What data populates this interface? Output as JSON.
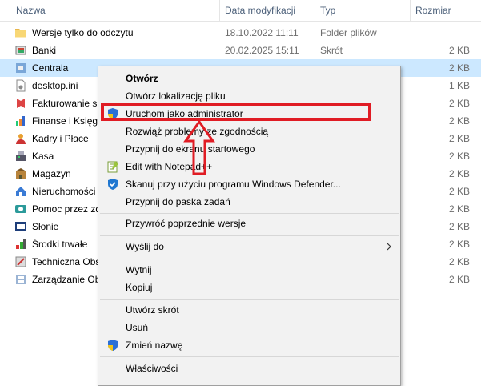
{
  "columns": {
    "name": "Nazwa",
    "date": "Data modyfikacji",
    "type": "Typ",
    "size": "Rozmiar"
  },
  "files": [
    {
      "name": "Wersje tylko do odczytu",
      "date": "18.10.2022 11:11",
      "type": "Folder plików",
      "size": "",
      "icon": "folder-icon"
    },
    {
      "name": "Banki",
      "date": "20.02.2025 15:11",
      "type": "Skrót",
      "size": "2 KB",
      "icon": "banki-shortcut-icon"
    },
    {
      "name": "Centrala",
      "date": "",
      "type": "",
      "size": "2 KB",
      "icon": "centrala-shortcut-icon",
      "selected": true
    },
    {
      "name": "desktop.ini",
      "date": "",
      "type": "",
      "size": "1 KB",
      "icon": "ini-file-icon"
    },
    {
      "name": "Fakturowanie sp",
      "date": "",
      "type": "",
      "size": "2 KB",
      "icon": "fakturowanie-shortcut-icon"
    },
    {
      "name": "Finanse i Księgo",
      "date": "",
      "type": "",
      "size": "2 KB",
      "icon": "finanse-shortcut-icon"
    },
    {
      "name": "Kadry i Płace",
      "date": "",
      "type": "",
      "size": "2 KB",
      "icon": "kadry-shortcut-icon"
    },
    {
      "name": "Kasa",
      "date": "",
      "type": "",
      "size": "2 KB",
      "icon": "kasa-shortcut-icon"
    },
    {
      "name": "Magazyn",
      "date": "",
      "type": "",
      "size": "2 KB",
      "icon": "magazyn-shortcut-icon"
    },
    {
      "name": "Nieruchomości",
      "date": "",
      "type": "",
      "size": "2 KB",
      "icon": "nieruchomosci-shortcut-icon"
    },
    {
      "name": "Pomoc przez zd",
      "date": "",
      "type": "",
      "size": "2 KB",
      "icon": "pomoc-shortcut-icon"
    },
    {
      "name": "Słonie",
      "date": "",
      "type": "",
      "size": "2 KB",
      "icon": "slonie-shortcut-icon"
    },
    {
      "name": "Środki trwałe",
      "date": "",
      "type": "",
      "size": "2 KB",
      "icon": "srodki-shortcut-icon"
    },
    {
      "name": "Techniczna Obs",
      "date": "",
      "type": "",
      "size": "2 KB",
      "icon": "techniczna-shortcut-icon"
    },
    {
      "name": "Zarządzanie Ob",
      "date": "",
      "type": "",
      "size": "2 KB",
      "icon": "zarzadzanie-shortcut-icon"
    }
  ],
  "context_menu": {
    "open": "Otwórz",
    "open_location": "Otwórz lokalizację pliku",
    "run_as_admin": "Uruchom jako administrator",
    "troubleshoot": "Rozwiąż problemy ze zgodnością",
    "pin_start": "Przypnij do ekranu startowego",
    "edit_notepad": "Edit with Notepad++",
    "scan_defender": "Skanuj przy użyciu programu Windows Defender...",
    "pin_taskbar": "Przypnij do paska zadań",
    "restore_versions": "Przywróć poprzednie wersje",
    "send_to": "Wyślij do",
    "cut": "Wytnij",
    "copy": "Kopiuj",
    "create_shortcut": "Utwórz skrót",
    "delete": "Usuń",
    "rename": "Zmień nazwę",
    "properties": "Właściwości"
  },
  "colors": {
    "selection": "#cce8ff",
    "annotation": "#e01c24",
    "menu_bg": "#f2f2f2",
    "folder": "#f8d775"
  }
}
